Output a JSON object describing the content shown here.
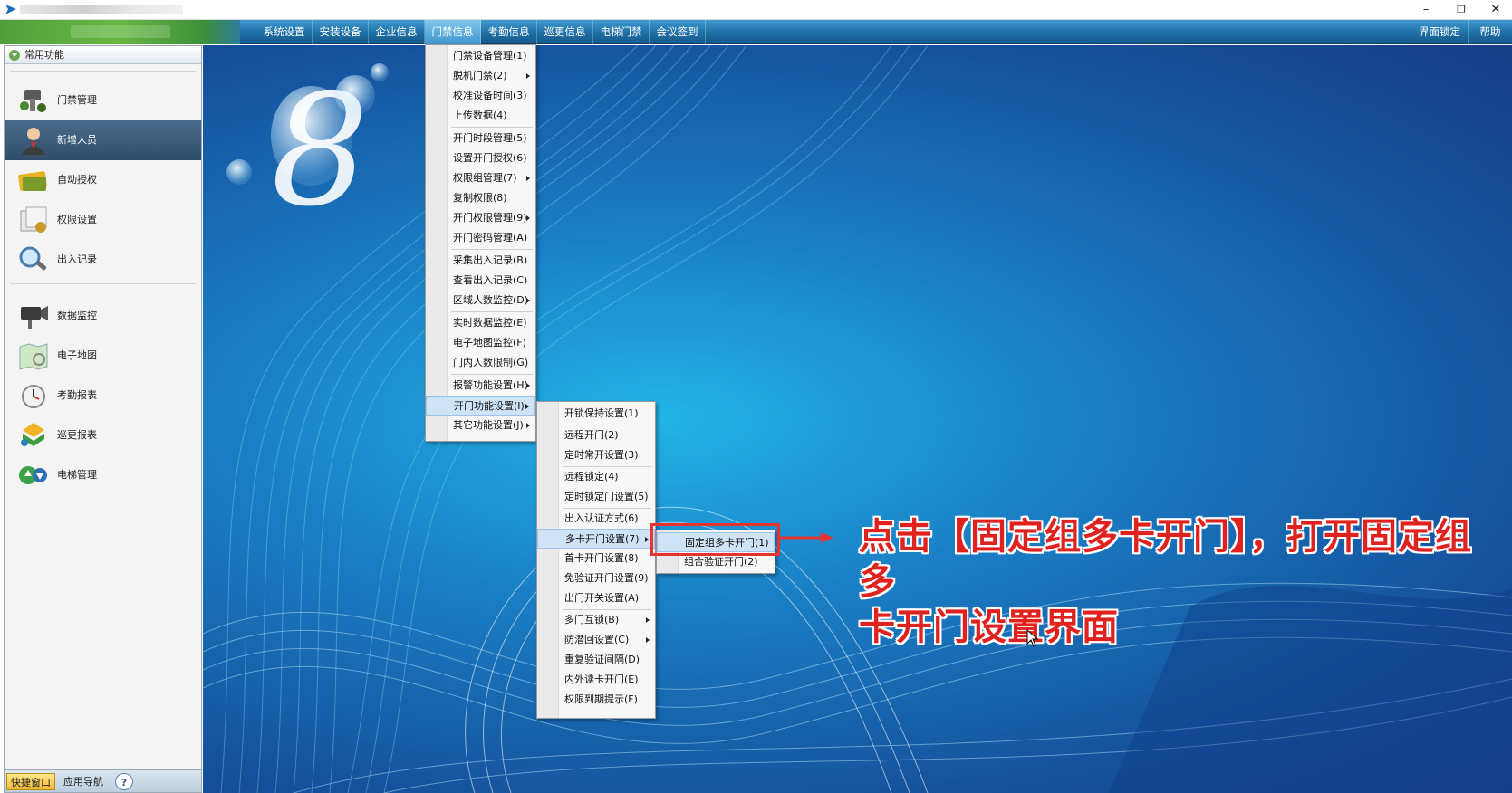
{
  "window": {
    "controls": {
      "minimize": "–",
      "restore": "❐",
      "close": "✕"
    }
  },
  "menubar": {
    "items": [
      "系统设置",
      "安装设备",
      "企业信息",
      "门禁信息",
      "考勤信息",
      "巡更信息",
      "电梯门禁",
      "会议签到"
    ],
    "active_index": 3,
    "right_items": [
      "界面锁定",
      "帮助"
    ]
  },
  "sidebar": {
    "header": "常用功能",
    "items": [
      {
        "label": "门禁管理",
        "icon": "door-control-icon"
      },
      {
        "label": "新增人员",
        "icon": "person-icon",
        "selected": true
      },
      {
        "label": "自动授权",
        "icon": "card-icon"
      },
      {
        "label": "权限设置",
        "icon": "permission-icon"
      },
      {
        "label": "出入记录",
        "icon": "magnifier-icon"
      },
      {
        "label": "数据监控",
        "icon": "camera-icon"
      },
      {
        "label": "电子地图",
        "icon": "map-icon"
      },
      {
        "label": "考勤报表",
        "icon": "clock-icon"
      },
      {
        "label": "巡更报表",
        "icon": "patrol-icon"
      },
      {
        "label": "电梯管理",
        "icon": "elevator-icon"
      }
    ],
    "tabs": [
      "快捷窗口",
      "应用导航",
      "?"
    ]
  },
  "menu_main": {
    "items": [
      "门禁设备管理(1)",
      "脱机门禁(2)",
      "校准设备时间(3)",
      "上传数据(4)",
      "开门时段管理(5)",
      "设置开门授权(6)",
      "权限组管理(7)",
      "复制权限(8)",
      "开门权限管理(9)",
      "开门密码管理(A)",
      "采集出入记录(B)",
      "查看出入记录(C)",
      "区域人数监控(D)",
      "实时数据监控(E)",
      "电子地图监控(F)",
      "门内人数限制(G)",
      "报警功能设置(H)",
      "开门功能设置(I)",
      "其它功能设置(J)"
    ]
  },
  "menu_door_functions": {
    "items": [
      "开锁保持设置(1)",
      "远程开门(2)",
      "定时常开设置(3)",
      "远程锁定(4)",
      "定时锁定门设置(5)",
      "出入认证方式(6)",
      "多卡开门设置(7)",
      "首卡开门设置(8)",
      "免验证开门设置(9)",
      "出门开关设置(A)",
      "多门互锁(B)",
      "防潜回设置(C)",
      "重复验证间隔(D)",
      "内外读卡开门(E)",
      "权限到期提示(F)"
    ]
  },
  "menu_multi_card": {
    "items": [
      "固定组多卡开门(1)",
      "组合验证开门(2)"
    ]
  },
  "annotation": {
    "line1": "点击【固定组多卡开门】，打开固定组多",
    "line2": "卡开门设置界面",
    "color": "#e0221f"
  },
  "colors": {
    "menubar": "#1f6fa6",
    "accent_green": "#67b843",
    "highlight": "#cfe3f7"
  }
}
